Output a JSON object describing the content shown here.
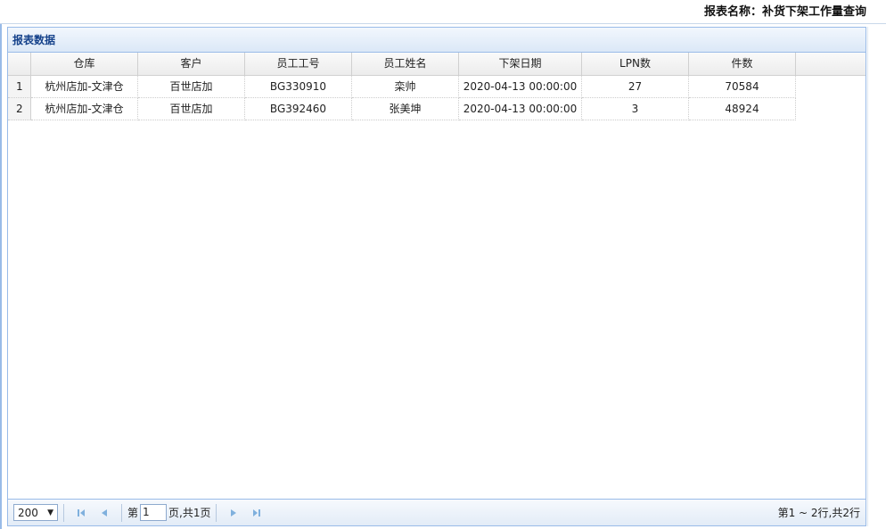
{
  "report_title": "报表名称：补货下架工作量查询",
  "panel": {
    "title": "报表数据"
  },
  "grid": {
    "columns": [
      "仓库",
      "客户",
      "员工工号",
      "员工姓名",
      "下架日期",
      "LPN数",
      "件数"
    ],
    "rows": [
      {
        "rownum": "1",
        "cells": [
          "杭州店加-文津仓",
          "百世店加",
          "BG330910",
          "栾帅",
          "2020-04-13 00:00:00",
          "27",
          "70584"
        ]
      },
      {
        "rownum": "2",
        "cells": [
          "杭州店加-文津仓",
          "百世店加",
          "BG392460",
          "张美坤",
          "2020-04-13 00:00:00",
          "3",
          "48924"
        ]
      }
    ]
  },
  "pager": {
    "page_size": "200",
    "page_prefix": "第",
    "page_value": "1",
    "page_suffix": "页,共1页",
    "info": "第1 ~ 2行,共2行"
  },
  "colors": {
    "panel_border": "#99bbe8",
    "header_text": "#15428b",
    "nav_icon": "#7fb0dd"
  }
}
